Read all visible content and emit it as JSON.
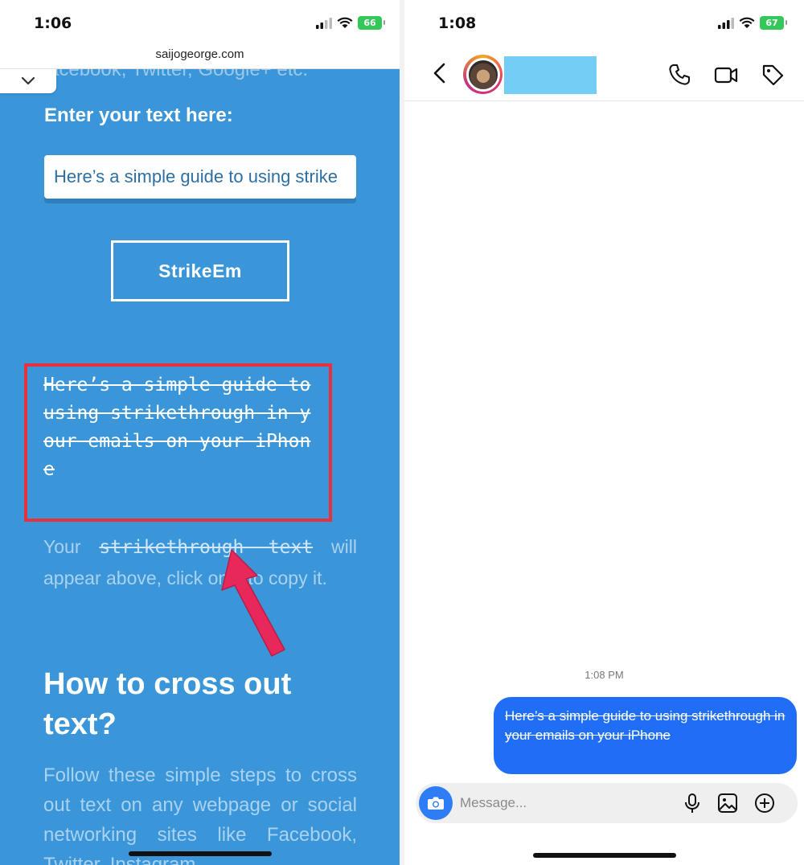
{
  "left_screen": {
    "status": {
      "time": "1:06",
      "battery": "66"
    },
    "url": "saijogeorge.com",
    "cut_text": "acebook, Twitter, Google+ etc.",
    "enter_label": "Enter your text here:",
    "input_value": "Here’s a simple guide to using strike",
    "button_label": "StrikeEm",
    "result_text": "Here’s a simple guide to using strikethrough in your emails on your iPhone",
    "hint_before": "Your ",
    "hint_mono": "strikethrough text",
    "hint_after": " will appear above, click on it to copy it.",
    "heading": "How to cross out text?",
    "follow_text": "Follow these simple steps to cross out text on any webpage or social networking sites like Facebook, Twitter, Instagram"
  },
  "right_screen": {
    "status": {
      "time": "1:08",
      "battery": "67"
    },
    "timestamp": "1:08 PM",
    "message": "Here’s a simple guide to using strikethrough in your emails on your iPhone",
    "composer_placeholder": "Message..."
  },
  "colors": {
    "site_blue": "#3a96d9",
    "highlight_red": "#e8313c",
    "arrow_pink": "#e8285a",
    "bubble_blue": "#1f6ef5",
    "redaction_blue": "#73cdf5"
  },
  "icons": [
    "cellular-icon",
    "wifi-icon",
    "battery-icon",
    "chevron-down-icon",
    "back-icon",
    "phone-icon",
    "video-icon",
    "tag-icon",
    "camera-icon",
    "microphone-icon",
    "gallery-icon",
    "add-icon"
  ]
}
